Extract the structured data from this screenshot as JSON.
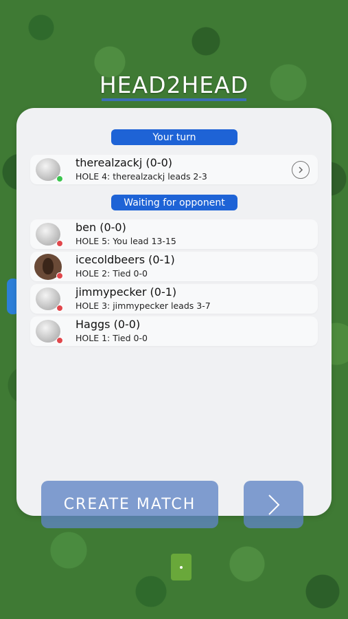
{
  "title": "HEAD2HEAD",
  "sections": {
    "your_turn_label": "Your turn",
    "waiting_label": "Waiting for opponent"
  },
  "your_turn": [
    {
      "name": "therealzackj (0-0)",
      "detail": "HOLE 4: therealzackj leads 2-3",
      "avatar": "golf-ball",
      "status": "online",
      "status_color": "#3cc44f"
    }
  ],
  "waiting": [
    {
      "name": "ben (0-0)",
      "detail": "HOLE 5: You lead 13-15",
      "avatar": "golf-ball",
      "status": "offline",
      "status_color": "#e0474c"
    },
    {
      "name": "icecoldbeers (0-1)",
      "detail": "HOLE 2: Tied 0-0",
      "avatar": "user-photo",
      "status": "offline",
      "status_color": "#e0474c"
    },
    {
      "name": "jimmypecker (0-1)",
      "detail": "HOLE 3: jimmypecker leads 3-7",
      "avatar": "golf-ball",
      "status": "offline",
      "status_color": "#e0474c"
    },
    {
      "name": "Haggs (0-0)",
      "detail": "HOLE 1: Tied 0-0",
      "avatar": "golf-ball",
      "status": "offline",
      "status_color": "#e0474c"
    }
  ],
  "buttons": {
    "create_match": "CREATE  MATCH",
    "next_icon": "chevron-right-icon"
  },
  "colors": {
    "accent": "#1e63d6",
    "button": "#5f84c4",
    "panel": "#f0f1f3",
    "grass": "#3f7a34"
  }
}
